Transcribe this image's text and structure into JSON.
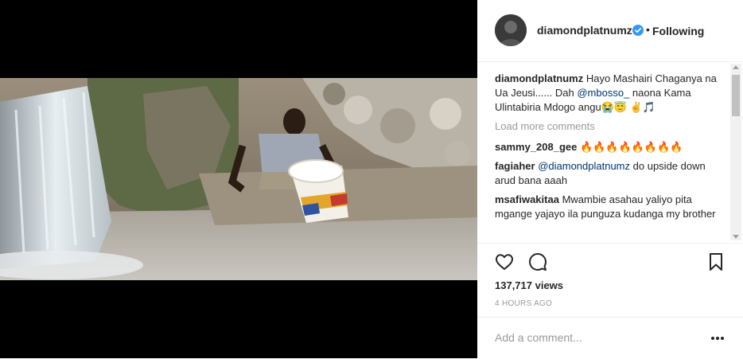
{
  "header": {
    "username": "diamondplatnumz",
    "separator": "•",
    "follow_state": "Following"
  },
  "caption": {
    "username": "diamondplatnumz",
    "text_before": "Hayo Mashairi Chaganya na Ua Jeusi...... Dah ",
    "mention": "@mbosso_",
    "text_after": " naona Kama Ulintabiria Mdogo angu😭😇 ✌🎵"
  },
  "load_more": "Load more comments",
  "comments": [
    {
      "username": "sammy_208_gee",
      "text": "🔥🔥🔥🔥🔥🔥🔥🔥",
      "mention": ""
    },
    {
      "username": "fagiaher",
      "mention": "@diamondplatnumz",
      "text": " do upside down arud bana aaah"
    },
    {
      "username": "msafiwakitaa",
      "text": "Mwambie asahau yaliyo pita mgange yajayo ila punguza kudanga my brother",
      "mention": ""
    }
  ],
  "stats": {
    "views": "137,717 views",
    "time": "4 HOURS AGO"
  },
  "comment_input": {
    "placeholder": "Add a comment..."
  },
  "icons": {
    "like": "heart-icon",
    "comment": "comment-icon",
    "save": "bookmark-icon",
    "more": "more-options-icon",
    "verified": "verified-badge-icon"
  },
  "colors": {
    "verified_blue": "#3897f0",
    "mention": "#003569",
    "muted": "#999999"
  }
}
